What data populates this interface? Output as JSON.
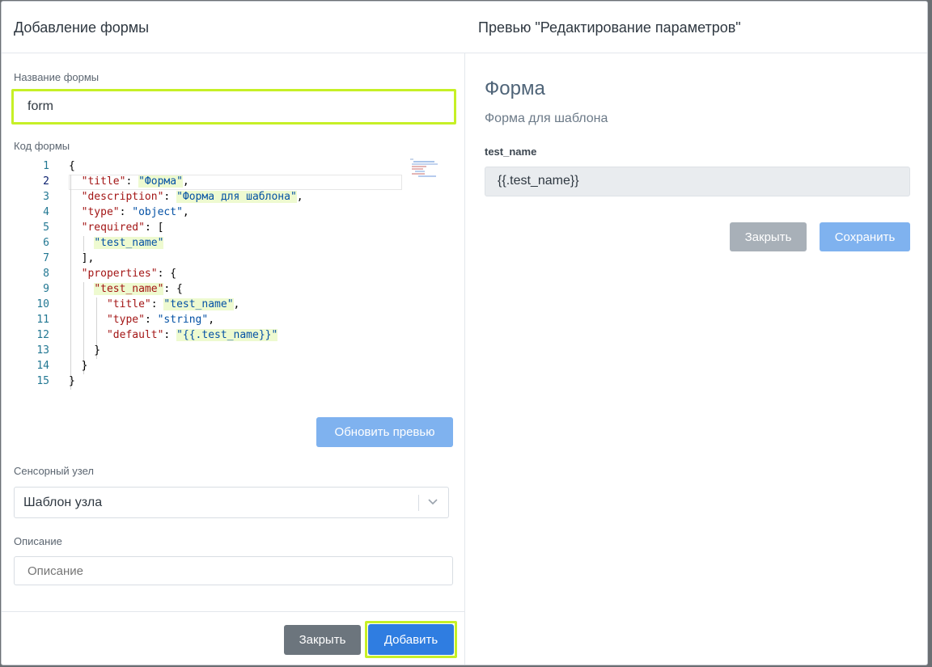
{
  "header": {
    "left_title": "Добавление формы",
    "right_title": "Превью \"Редактирование параметров\""
  },
  "form_name": {
    "label": "Название формы",
    "value": "form"
  },
  "code": {
    "label": "Код формы",
    "lines": [
      {
        "n": "1",
        "segs": [
          {
            "t": "{",
            "c": "p"
          }
        ]
      },
      {
        "n": "2",
        "segs": [
          {
            "t": "  ",
            "c": "p"
          },
          {
            "t": "\"title\"",
            "c": "k"
          },
          {
            "t": ": ",
            "c": "p"
          },
          {
            "t": "\"Форма\"",
            "c": "s hi"
          },
          {
            "t": ",",
            "c": "p"
          }
        ]
      },
      {
        "n": "3",
        "segs": [
          {
            "t": "  ",
            "c": "p"
          },
          {
            "t": "\"description\"",
            "c": "k"
          },
          {
            "t": ": ",
            "c": "p"
          },
          {
            "t": "\"Форма для шаблона\"",
            "c": "s hi"
          },
          {
            "t": ",",
            "c": "p"
          }
        ]
      },
      {
        "n": "4",
        "segs": [
          {
            "t": "  ",
            "c": "p"
          },
          {
            "t": "\"type\"",
            "c": "k"
          },
          {
            "t": ": ",
            "c": "p"
          },
          {
            "t": "\"object\"",
            "c": "s"
          },
          {
            "t": ",",
            "c": "p"
          }
        ]
      },
      {
        "n": "5",
        "segs": [
          {
            "t": "  ",
            "c": "p"
          },
          {
            "t": "\"required\"",
            "c": "k"
          },
          {
            "t": ": [",
            "c": "p"
          }
        ]
      },
      {
        "n": "6",
        "segs": [
          {
            "t": "    ",
            "c": "p"
          },
          {
            "t": "\"test_name\"",
            "c": "s hi"
          }
        ]
      },
      {
        "n": "7",
        "segs": [
          {
            "t": "  ],",
            "c": "p"
          }
        ]
      },
      {
        "n": "8",
        "segs": [
          {
            "t": "  ",
            "c": "p"
          },
          {
            "t": "\"properties\"",
            "c": "k"
          },
          {
            "t": ": {",
            "c": "p"
          }
        ]
      },
      {
        "n": "9",
        "segs": [
          {
            "t": "    ",
            "c": "p"
          },
          {
            "t": "\"test_name\"",
            "c": "k hi"
          },
          {
            "t": ": {",
            "c": "p"
          }
        ]
      },
      {
        "n": "10",
        "segs": [
          {
            "t": "      ",
            "c": "p"
          },
          {
            "t": "\"title\"",
            "c": "k"
          },
          {
            "t": ": ",
            "c": "p"
          },
          {
            "t": "\"test_name\"",
            "c": "s hi"
          },
          {
            "t": ",",
            "c": "p"
          }
        ]
      },
      {
        "n": "11",
        "segs": [
          {
            "t": "      ",
            "c": "p"
          },
          {
            "t": "\"type\"",
            "c": "k"
          },
          {
            "t": ": ",
            "c": "p"
          },
          {
            "t": "\"string\"",
            "c": "s"
          },
          {
            "t": ",",
            "c": "p"
          }
        ]
      },
      {
        "n": "12",
        "segs": [
          {
            "t": "      ",
            "c": "p"
          },
          {
            "t": "\"default\"",
            "c": "k"
          },
          {
            "t": ": ",
            "c": "p"
          },
          {
            "t": "\"{{.test_name}}\"",
            "c": "s hi"
          }
        ]
      },
      {
        "n": "13",
        "segs": [
          {
            "t": "    }",
            "c": "p"
          }
        ]
      },
      {
        "n": "14",
        "segs": [
          {
            "t": "  }",
            "c": "p"
          }
        ]
      },
      {
        "n": "15",
        "segs": [
          {
            "t": "}",
            "c": "p"
          }
        ]
      }
    ]
  },
  "refresh_button": "Обновить превью",
  "sensor_node": {
    "label": "Сенсорный узел",
    "value": "Шаблон узла"
  },
  "description": {
    "label": "Описание",
    "placeholder": "Описание"
  },
  "footer": {
    "close": "Закрыть",
    "add": "Добавить"
  },
  "preview": {
    "title": "Форма",
    "subtitle": "Форма для шаблона",
    "field_label": "test_name",
    "field_value": "{{.test_name}}",
    "close": "Закрыть",
    "save": "Сохранить"
  },
  "colors": {
    "highlight": "#c6f026",
    "primary": "#2f7de1",
    "primary_light": "#7fb2ef",
    "secondary": "#6c757d",
    "secondary_light": "#a8b0b8"
  }
}
